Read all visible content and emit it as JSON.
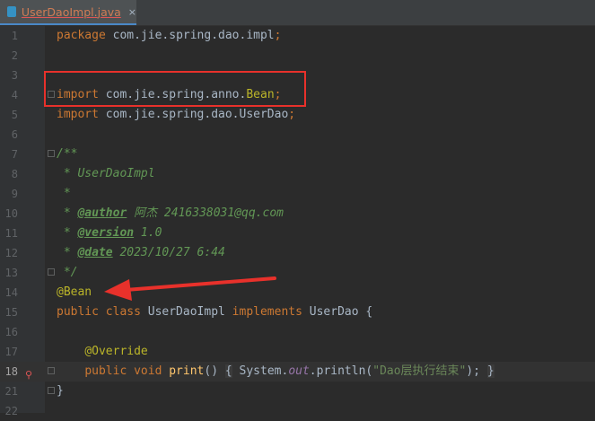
{
  "tab": {
    "label": "UserDaoImpl.java",
    "close": "×",
    "icon": "java-class-icon"
  },
  "lines": [
    {
      "n": "1",
      "segs": [
        [
          "kw",
          "package "
        ],
        [
          "pl",
          "com.jie.spring.dao.impl"
        ],
        [
          "kw",
          ";"
        ]
      ]
    },
    {
      "n": "2",
      "segs": []
    },
    {
      "n": "3",
      "segs": []
    },
    {
      "n": "4",
      "segs": [
        [
          "kw",
          "import "
        ],
        [
          "pl",
          "com.jie.spring.anno."
        ],
        [
          "ann",
          "Bean"
        ],
        [
          "kw",
          ";"
        ]
      ]
    },
    {
      "n": "5",
      "segs": [
        [
          "kw",
          "import "
        ],
        [
          "pl",
          "com.jie.spring.dao.UserDao"
        ],
        [
          "kw",
          ";"
        ]
      ]
    },
    {
      "n": "6",
      "segs": []
    },
    {
      "n": "7",
      "segs": [
        [
          "cm",
          "/**"
        ]
      ]
    },
    {
      "n": "8",
      "segs": [
        [
          "cm",
          " * UserDaoImpl"
        ]
      ]
    },
    {
      "n": "9",
      "segs": [
        [
          "cm",
          " *"
        ]
      ]
    },
    {
      "n": "10",
      "segs": [
        [
          "cm",
          " * "
        ],
        [
          "tag",
          "@author"
        ],
        [
          "cm",
          " 阿杰 2416338031@qq.com"
        ]
      ]
    },
    {
      "n": "11",
      "segs": [
        [
          "cm",
          " * "
        ],
        [
          "tag",
          "@version"
        ],
        [
          "cm",
          " 1.0"
        ]
      ]
    },
    {
      "n": "12",
      "segs": [
        [
          "cm",
          " * "
        ],
        [
          "tag",
          "@date"
        ],
        [
          "cm",
          " 2023/10/27 6:44"
        ]
      ]
    },
    {
      "n": "13",
      "segs": [
        [
          "cm",
          " */"
        ]
      ]
    },
    {
      "n": "14",
      "segs": [
        [
          "ann",
          "@Bean"
        ]
      ]
    },
    {
      "n": "15",
      "segs": [
        [
          "kw",
          "public class "
        ],
        [
          "pl",
          "UserDaoImpl "
        ],
        [
          "kw",
          "implements "
        ],
        [
          "pl",
          "UserDao {"
        ]
      ]
    },
    {
      "n": "16",
      "segs": []
    },
    {
      "n": "17",
      "segs": [
        [
          "pl",
          "    "
        ],
        [
          "ann",
          "@Override"
        ]
      ]
    },
    {
      "n": "18",
      "segs": [
        [
          "pl",
          "    "
        ],
        [
          "kw",
          "public void "
        ],
        [
          "mth",
          "print"
        ],
        [
          "pl",
          "() "
        ],
        [
          "brace",
          "{"
        ],
        [
          "pl",
          " System."
        ],
        [
          "fld",
          "out"
        ],
        [
          "pl",
          ".println("
        ],
        [
          "str",
          "\"Dao层执行结束\""
        ],
        [
          "pl",
          ");"
        ],
        [
          "pl",
          " "
        ],
        [
          "brace",
          "}"
        ]
      ]
    },
    {
      "n": "21",
      "segs": [
        [
          "pl",
          "}"
        ]
      ]
    },
    {
      "n": "22",
      "segs": []
    }
  ],
  "colors": {
    "highlight_box": "#e8312b",
    "arrow": "#e8312b"
  }
}
